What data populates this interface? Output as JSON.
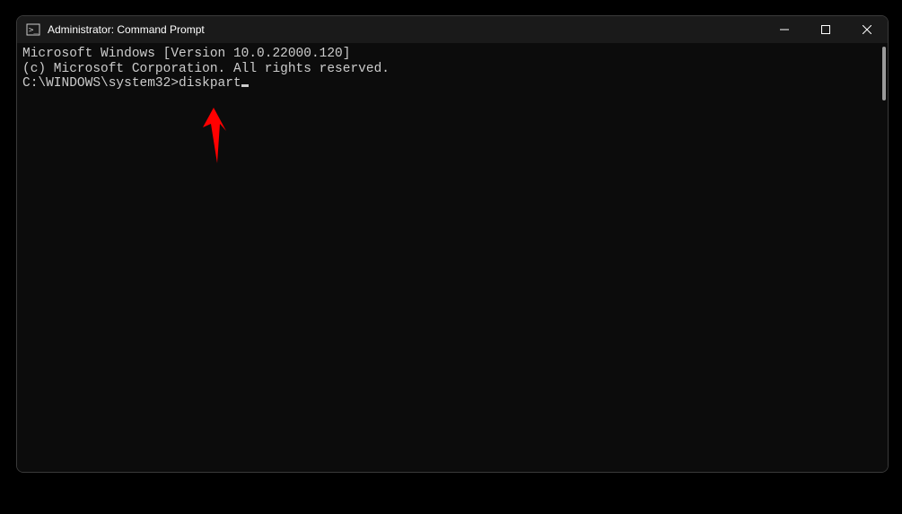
{
  "window": {
    "title": "Administrator: Command Prompt"
  },
  "terminal": {
    "line1": "Microsoft Windows [Version 10.0.22000.120]",
    "line2": "(c) Microsoft Corporation. All rights reserved.",
    "blank": "",
    "prompt": "C:\\WINDOWS\\system32>",
    "typed": "diskpart"
  }
}
